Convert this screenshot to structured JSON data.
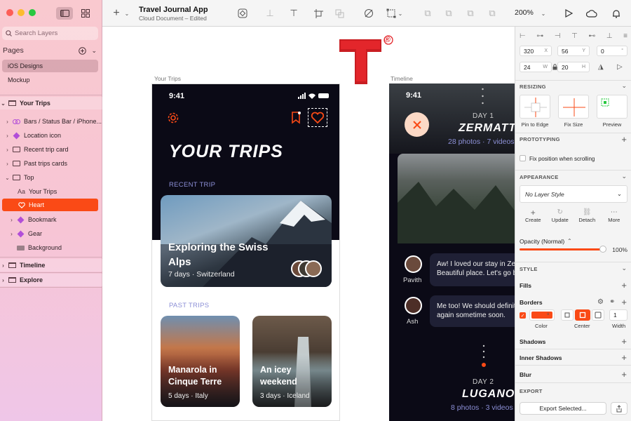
{
  "app": {
    "doc_title": "Travel Journal App",
    "doc_subtitle": "Cloud Document – Edited",
    "zoom": "200%"
  },
  "sidebar": {
    "search_placeholder": "Search Layers",
    "pages_label": "Pages",
    "pages": [
      {
        "label": "iOS Designs",
        "selected": true
      },
      {
        "label": "Mockup",
        "selected": false
      }
    ],
    "layers": [
      {
        "label": "Your Trips",
        "icon": "artboard-icon",
        "level": 0,
        "bold": true
      },
      {
        "label": "Bars / Status Bar / iPhone...",
        "icon": "symbol-icon",
        "level": 1
      },
      {
        "label": "Location icon",
        "icon": "symbol-icon",
        "level": 1
      },
      {
        "label": "Recent trip card",
        "icon": "folder-icon",
        "level": 1
      },
      {
        "label": "Past trips cards",
        "icon": "folder-icon",
        "level": 1
      },
      {
        "label": "Top",
        "icon": "folder-icon",
        "level": 1
      },
      {
        "label": "Your Trips",
        "icon": "text-icon",
        "level": 2
      },
      {
        "label": "Heart",
        "icon": "heart-icon",
        "level": 2,
        "selected": true
      },
      {
        "label": "Bookmark",
        "icon": "symbol-icon",
        "level": 2
      },
      {
        "label": "Gear",
        "icon": "symbol-icon",
        "level": 2
      },
      {
        "label": "Background",
        "icon": "rectangle-icon",
        "level": 2
      },
      {
        "label": "Timeline",
        "icon": "artboard-icon",
        "level": 0,
        "bold": true
      },
      {
        "label": "Explore",
        "icon": "artboard-icon",
        "level": 0,
        "bold": true
      }
    ]
  },
  "canvas": {
    "artboard1_label": "Your Trips",
    "artboard2_label": "Timeline",
    "logo_mark": "®",
    "your_trips": {
      "time": "9:41",
      "title": "YOUR TRIPS",
      "recent_label": "RECENT TRIP",
      "recent_title": "Exploring the Swiss Alps",
      "recent_meta": "7 days · Switzerland",
      "past_label": "PAST TRIPS",
      "past_cards": [
        {
          "title": "Manarola in Cinque Terre",
          "meta": "5 days · Italy"
        },
        {
          "title": "An icey weekend",
          "meta": "3 days · Iceland"
        }
      ]
    },
    "timeline": {
      "time": "9:41",
      "day1": "DAY 1",
      "place1": "ZERMATT",
      "meta1": "28 photos · 7 videos",
      "comments": [
        {
          "user": "Pavith",
          "text": "Aw! I loved our stay in Zermatt. Beautiful place. Let's go back!"
        },
        {
          "user": "Ash",
          "text": "Me too! We should definitely go again sometime soon."
        }
      ],
      "day2": "DAY 2",
      "place2": "LUGANO",
      "meta2": "8 photos · 3 videos"
    }
  },
  "inspector": {
    "x": "320",
    "x_unit": "X",
    "y": "56",
    "y_unit": "Y",
    "rot": "0",
    "rot_unit": "°",
    "w": "24",
    "w_unit": "W",
    "h": "20",
    "h_unit": "H",
    "resizing_label": "RESIZING",
    "resize_options": [
      "Pin to Edge",
      "Fix Size",
      "Preview"
    ],
    "prototyping_label": "PROTOTYPING",
    "fix_position_label": "Fix position when scrolling",
    "appearance_label": "APPEARANCE",
    "layer_style": "No Layer Style",
    "style_actions": [
      "Create",
      "Update",
      "Detach",
      "More"
    ],
    "opacity_label": "Opacity (Normal)",
    "opacity_value": "100%",
    "opacity": 1.0,
    "style_label": "STYLE",
    "fills_label": "Fills",
    "borders_label": "Borders",
    "border_color_label": "Color",
    "border_position_label": "Center",
    "border_width_label": "Width",
    "border_width": "1",
    "shadows_label": "Shadows",
    "inner_shadows_label": "Inner Shadows",
    "blur_label": "Blur",
    "export_label": "EXPORT",
    "export_button": "Export Selected..."
  },
  "colors": {
    "accent": "#fa4a16",
    "phone_bg": "#0b0a16",
    "logo_red": "#e3262b",
    "section_label": "#8c8fd6"
  }
}
